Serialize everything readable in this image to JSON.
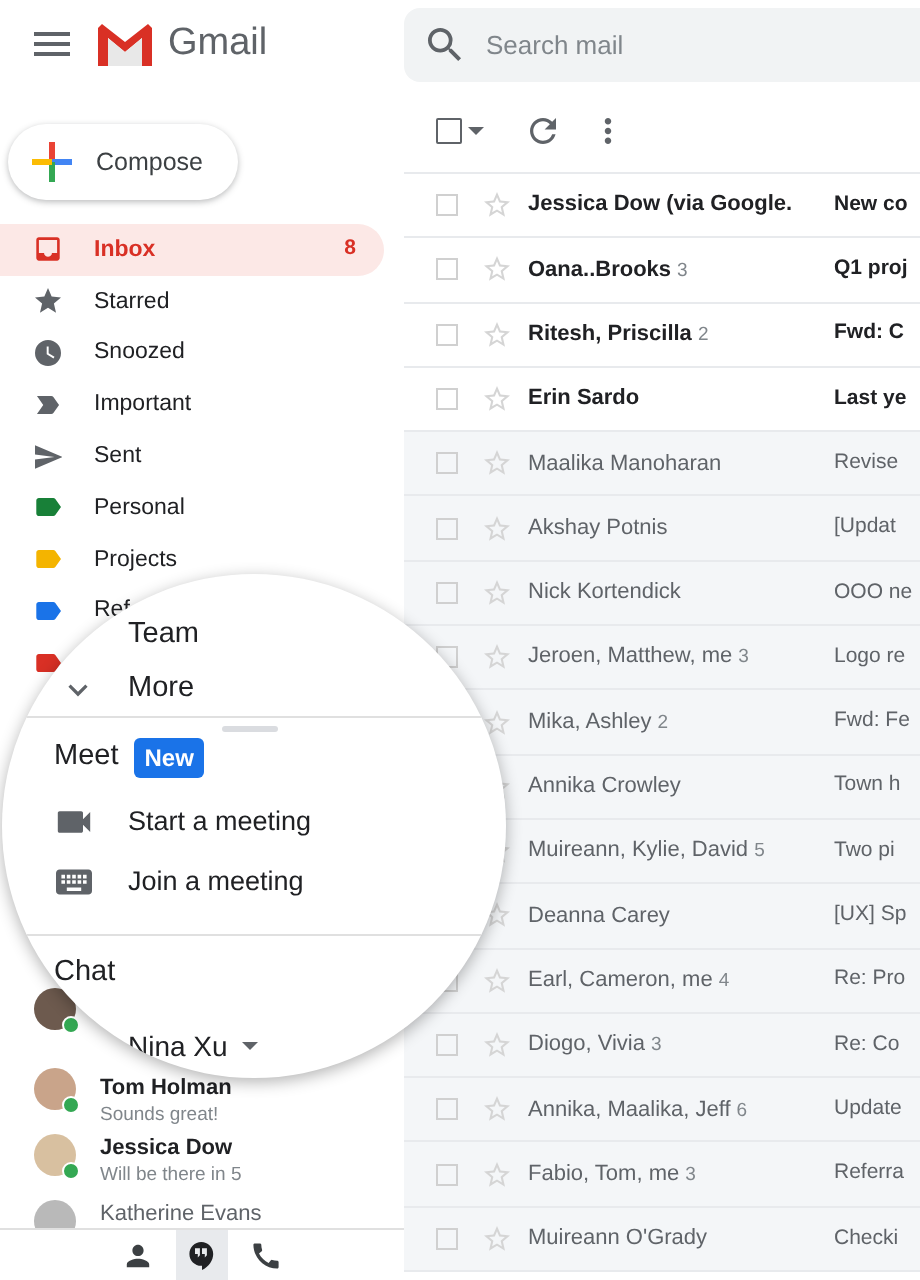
{
  "header": {
    "app_name": "Gmail"
  },
  "search": {
    "placeholder": "Search mail"
  },
  "toolbar": {
    "select_all_checked": false
  },
  "compose": {
    "label": "Compose"
  },
  "nav": [
    {
      "kind": "inbox",
      "label": "Inbox",
      "count": "8",
      "selected": true
    },
    {
      "kind": "star",
      "label": "Starred",
      "selected": false
    },
    {
      "kind": "clock",
      "label": "Snoozed",
      "selected": false
    },
    {
      "kind": "important",
      "label": "Important",
      "selected": false
    },
    {
      "kind": "send",
      "label": "Sent",
      "selected": false
    },
    {
      "kind": "label",
      "label": "Personal",
      "color": "#188038",
      "selected": false
    },
    {
      "kind": "label",
      "label": "Projects",
      "color": "#f4b400",
      "selected": false
    },
    {
      "kind": "label",
      "label": "Ref",
      "color": "#1a73e8",
      "selected": false
    },
    {
      "kind": "label",
      "color": "#d93025",
      "selected": false
    }
  ],
  "magnifier": {
    "items": [
      {
        "kind": "plain",
        "label": "Team"
      },
      {
        "kind": "more",
        "label": "More"
      }
    ],
    "meet": {
      "title": "Meet",
      "badge": "New",
      "actions": [
        {
          "kind": "video",
          "label": "Start a meeting"
        },
        {
          "kind": "keyboard",
          "label": "Join a meeting"
        }
      ]
    },
    "chat": {
      "title": "Chat",
      "user": "Nina Xu"
    }
  },
  "chats": [
    {
      "online": true
    },
    {
      "name": "Tom Holman",
      "message": "Sounds great!",
      "online": true,
      "unread": true
    },
    {
      "name": "Jessica Dow",
      "message": "Will be there in 5",
      "online": true,
      "unread": true
    },
    {
      "name": "Katherine Evans",
      "unread": false
    }
  ],
  "bottom_tabs": [
    {
      "kind": "contacts",
      "selected": false
    },
    {
      "kind": "hangouts",
      "selected": true
    },
    {
      "kind": "phone",
      "selected": false
    }
  ],
  "mails": [
    {
      "sender": "Jessica Dow (via Google.",
      "subject": "New co",
      "unread": true,
      "checked": false
    },
    {
      "sender": "Oana..Brooks",
      "count": "3",
      "subject": "Q1 proj",
      "unread": true,
      "checked": false
    },
    {
      "sender": "Ritesh, Priscilla",
      "count": "2",
      "subject": "Fwd: C",
      "unread": true,
      "checked": false
    },
    {
      "sender": "Erin Sardo",
      "subject": "Last ye",
      "unread": true,
      "checked": false
    },
    {
      "sender": "Maalika Manoharan",
      "subject": "Revise",
      "unread": false,
      "checked": false
    },
    {
      "sender": "Akshay Potnis",
      "subject": "[Updat",
      "unread": false,
      "checked": false
    },
    {
      "sender": "Nick Kortendick",
      "subject": "OOO ne",
      "unread": false,
      "checked": false
    },
    {
      "sender": "Jeroen, Matthew, me",
      "count": "3",
      "subject": "Logo re",
      "unread": false,
      "checked": false
    },
    {
      "sender": "Mika, Ashley",
      "count": "2",
      "subject": "Fwd: Fe",
      "unread": false
    },
    {
      "sender": "Annika Crowley",
      "subject": "Town h",
      "unread": false
    },
    {
      "sender": "Muireann, Kylie, David",
      "count": "5",
      "subject": "Two pi",
      "unread": false
    },
    {
      "sender": "Deanna Carey",
      "subject": "[UX] Sp",
      "unread": false
    },
    {
      "sender": "Earl, Cameron, me",
      "count": "4",
      "subject": "Re: Pro",
      "unread": false,
      "checked": false
    },
    {
      "sender": "Diogo, Vivia",
      "count": "3",
      "subject": "Re: Co",
      "unread": false,
      "checked": false
    },
    {
      "sender": "Annika, Maalika, Jeff",
      "count": "6",
      "subject": "Update",
      "unread": false,
      "checked": false
    },
    {
      "sender": "Fabio, Tom, me",
      "count": "3",
      "subject": "Referra",
      "unread": false,
      "checked": false
    },
    {
      "sender": "Muireann O'Grady",
      "subject": "Checki",
      "unread": false,
      "checked": false
    }
  ]
}
